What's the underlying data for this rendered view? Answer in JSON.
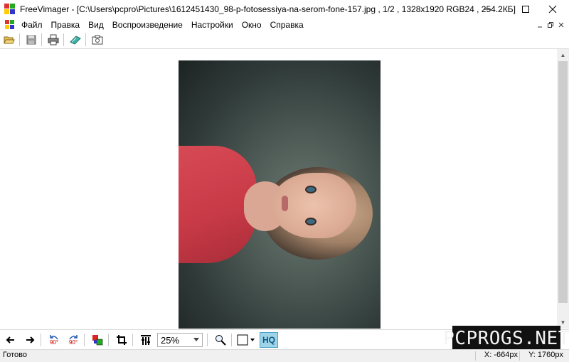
{
  "window": {
    "title": "FreeVimager - [C:\\Users\\pcpro\\Pictures\\1612451430_98-p-fotosessiya-na-serom-fone-157.jpg , 1/2 , 1328x1920 RGB24 , 254.2КБ]",
    "minimize_icon": "minimize-icon",
    "maximize_icon": "maximize-icon",
    "close_icon": "close-icon"
  },
  "menu": {
    "items": [
      "Файл",
      "Правка",
      "Вид",
      "Воспроизведение",
      "Настройки",
      "Окно",
      "Справка"
    ]
  },
  "toolbar": {
    "icons": [
      "open-folder-icon",
      "save-icon",
      "print-icon",
      "scan-icon",
      "screenshot-icon"
    ]
  },
  "navigation": {
    "rotate_left_label": "90°",
    "rotate_right_label": "90°"
  },
  "zoom": {
    "value": "25%"
  },
  "hq_label": "HQ",
  "watermark": "PCPROGS.NET",
  "status": {
    "text": "Готово",
    "x": "X: -664px",
    "y": "Y: 1760px"
  },
  "colors": {
    "hq_bg": "#9fd3e8",
    "watermark_bg": "#111111"
  }
}
